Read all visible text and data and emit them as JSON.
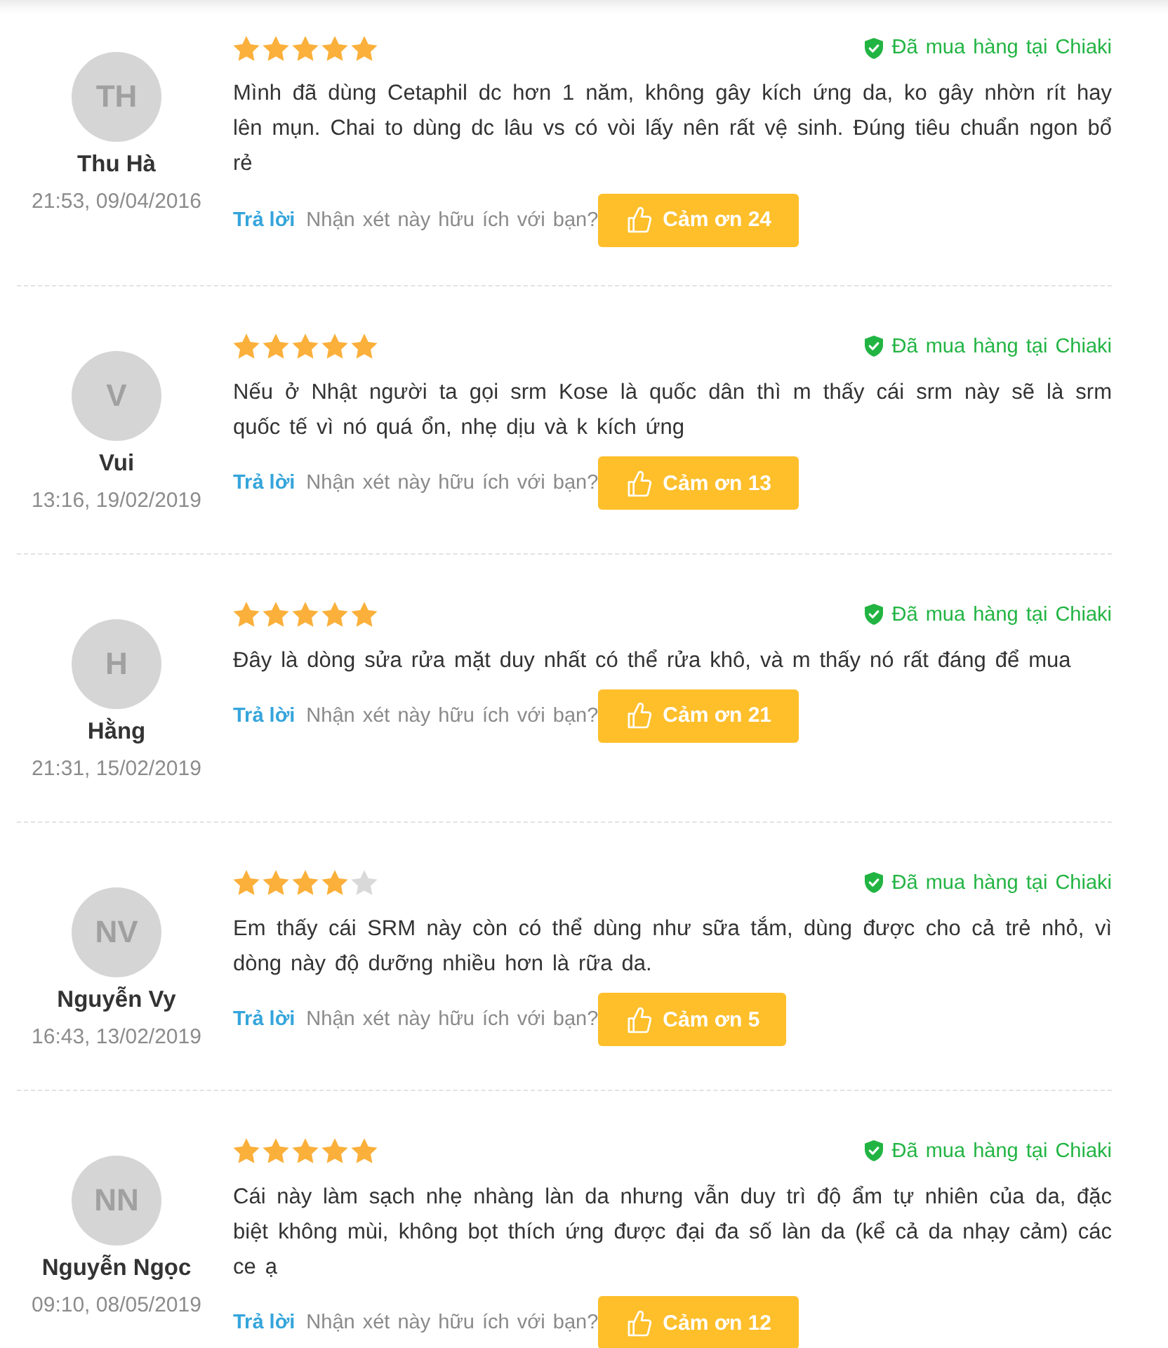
{
  "reviews": [
    {
      "initials": "TH",
      "name": "Thu Hà",
      "time": "21:53, 09/04/2016",
      "stars": 5,
      "badge": "Đã mua hàng tại Chiaki",
      "text": "Mình đã dùng Cetaphil dc hơn 1 năm, không gây kích ứng da, ko gây nhờn rít hay lên mụn. Chai to dùng dc lâu vs có vòi lấy nên rất vệ sinh. Đúng tiêu chuẩn ngon bổ rẻ",
      "reply": "Trả lời",
      "helpful_prompt": "Nhận xét này hữu ích với bạn?",
      "thanks_button": "Cảm ơn 24"
    },
    {
      "initials": "V",
      "name": "Vui",
      "time": "13:16, 19/02/2019",
      "stars": 5,
      "badge": "Đã mua hàng tại Chiaki",
      "text": "Nếu ở Nhật người ta gọi srm Kose là quốc dân thì m thấy cái srm này sẽ là srm quốc tế vì nó quá ổn, nhẹ dịu và k kích ứng",
      "reply": "Trả lời",
      "helpful_prompt": "Nhận xét này hữu ích với bạn?",
      "thanks_button": "Cảm ơn 13"
    },
    {
      "initials": "H",
      "name": "Hằng",
      "time": "21:31, 15/02/2019",
      "stars": 5,
      "badge": "Đã mua hàng tại Chiaki",
      "text": "Đây là dòng sửa rửa mặt duy nhất có thể rửa khô, và m thấy nó rất đáng để mua",
      "reply": "Trả lời",
      "helpful_prompt": "Nhận xét này hữu ích với bạn?",
      "thanks_button": "Cảm ơn 21"
    },
    {
      "initials": "NV",
      "name": "Nguyễn Vy",
      "time": "16:43, 13/02/2019",
      "stars": 4,
      "badge": "Đã mua hàng tại Chiaki",
      "text": "Em thấy cái SRM này còn có thể dùng như sữa tắm, dùng được cho cả trẻ nhỏ, vì dòng này độ dưỡng nhiều hơn là rữa da.",
      "reply": "Trả lời",
      "helpful_prompt": "Nhận xét này hữu ích với bạn?",
      "thanks_button": "Cảm ơn 5"
    },
    {
      "initials": "NN",
      "name": "Nguyễn Ngọc",
      "time": "09:10, 08/05/2019",
      "stars": 5,
      "badge": "Đã mua hàng tại Chiaki",
      "text": "Cái này làm sạch nhẹ nhàng làn da nhưng vẫn duy trì độ ẩm tự nhiên của da, đặc biệt không mùi, không bọt thích ứng được đại đa số làn da (kể cả da nhạy cảm) các ce ạ",
      "reply": "Trả lời",
      "helpful_prompt": "Nhận xét này hữu ích với bạn?",
      "thanks_button": "Cảm ơn 12"
    }
  ]
}
